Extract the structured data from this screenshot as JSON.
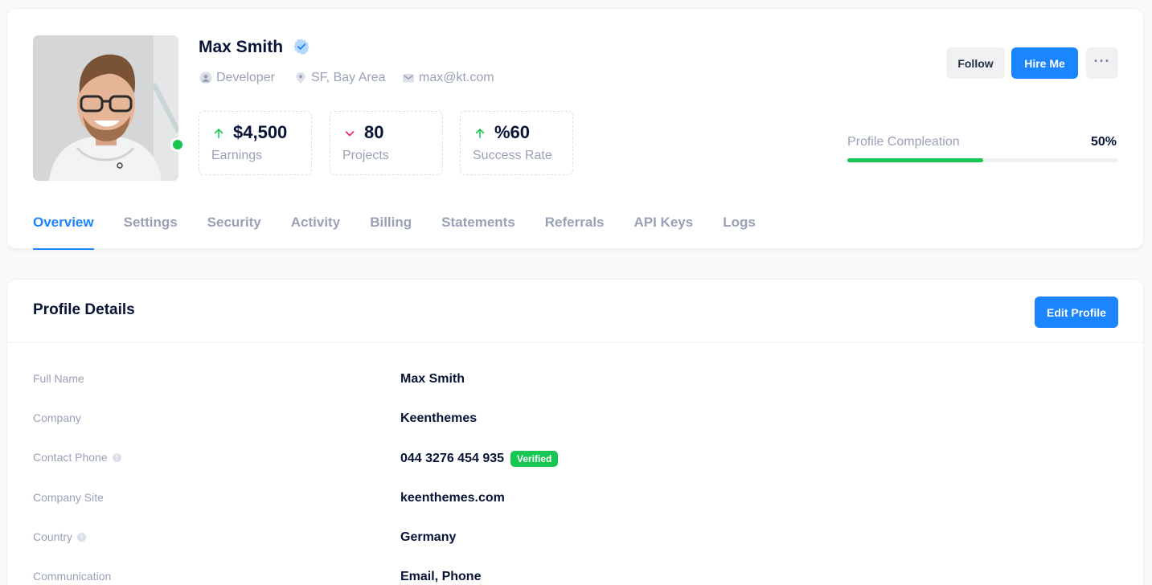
{
  "profile": {
    "name": "Max Smith",
    "role": "Developer",
    "location": "SF, Bay Area",
    "email": "max@kt.com"
  },
  "stats": [
    {
      "value": "$4,500",
      "label": "Earnings",
      "trend": "up"
    },
    {
      "value": "80",
      "label": "Projects",
      "trend": "down"
    },
    {
      "value": "%60",
      "label": "Success Rate",
      "trend": "up"
    }
  ],
  "actions": {
    "follow": "Follow",
    "hire": "Hire Me",
    "more": "···"
  },
  "progress": {
    "label": "Profile Compleation",
    "value_text": "50%",
    "fraction": 0.5
  },
  "tabs": [
    "Overview",
    "Settings",
    "Security",
    "Activity",
    "Billing",
    "Statements",
    "Referrals",
    "API Keys",
    "Logs"
  ],
  "active_tab": "Overview",
  "details": {
    "title": "Profile Details",
    "edit_button": "Edit Profile",
    "rows": [
      {
        "label": "Full Name",
        "value": "Max Smith"
      },
      {
        "label": "Company",
        "value": "Keenthemes"
      },
      {
        "label": "Contact Phone",
        "value": "044 3276 454 935",
        "badge": "Verified"
      },
      {
        "label": "Company Site",
        "value": "keenthemes.com"
      },
      {
        "label": "Country",
        "value": "Germany"
      },
      {
        "label": "Communication",
        "value": "Email, Phone"
      }
    ]
  },
  "colors": {
    "primary": "#1b84ff",
    "success": "#17c653",
    "danger": "#f8285a",
    "muted": "#99a1b7",
    "heading": "#071437"
  },
  "icons": {
    "verified": "verified-badge-icon",
    "role": "user-icon",
    "location": "map-pin-icon",
    "email": "envelope-icon",
    "trend_up": "arrow-up-icon",
    "trend_down": "arrow-down-icon",
    "more": "dots-horizontal-icon",
    "info": "info-icon"
  }
}
